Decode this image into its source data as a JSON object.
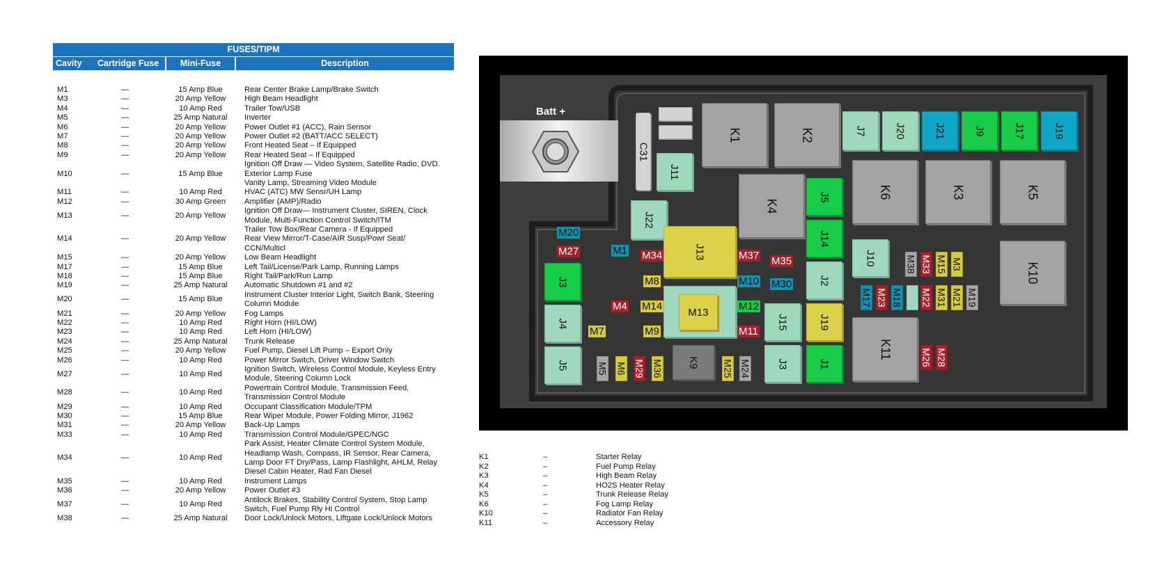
{
  "table": {
    "title": "FUSES/TIPM",
    "headers": {
      "cavity": "Cavity",
      "cartridge": "Cartridge Fuse",
      "mini": "Mini-Fuse",
      "description": "Description"
    },
    "rows": [
      {
        "cavity": "M1",
        "cartridge": "—",
        "mini": "15 Amp Blue",
        "desc": [
          "Rear Center Brake Lamp/Brake Switch"
        ]
      },
      {
        "cavity": "M3",
        "cartridge": "—",
        "mini": "20 Amp Yellow",
        "desc": [
          "High Beam Headlight"
        ]
      },
      {
        "cavity": "M4",
        "cartridge": "—",
        "mini": "10 Amp Red",
        "desc": [
          "Trailer Tow/USB"
        ]
      },
      {
        "cavity": "M5",
        "cartridge": "—",
        "mini": "25 Amp Natural",
        "desc": [
          "Inverter"
        ]
      },
      {
        "cavity": "M6",
        "cartridge": "—",
        "mini": "20 Amp Yellow",
        "desc": [
          "Power Outlet #1 (ACC), Rain Sensor"
        ]
      },
      {
        "cavity": "M7",
        "cartridge": "—",
        "mini": "20 Amp Yellow",
        "desc": [
          "Power Outlet #2 (BATT/ACC SELECT)"
        ]
      },
      {
        "cavity": "M8",
        "cartridge": "—",
        "mini": "20 Amp Yellow",
        "desc": [
          "Front Heated Seat – If Equipped"
        ]
      },
      {
        "cavity": "M9",
        "cartridge": "—",
        "mini": "20 Amp Yellow",
        "desc": [
          "Rear Heated Seat – If Equipped"
        ]
      },
      {
        "cavity": "M10",
        "cartridge": "—",
        "mini": "15 Amp Blue",
        "desc": [
          "Ignition Off Draw — Video System, Satellite Radio, DVD.",
          "Exterior Lamp Fuse",
          "Vanity Lamp, Streaming Video Module"
        ]
      },
      {
        "cavity": "M11",
        "cartridge": "—",
        "mini": "10 Amp Red",
        "desc": [
          "HVAC (ATC) MW Sensr/UH Lamp"
        ]
      },
      {
        "cavity": "M12",
        "cartridge": "—",
        "mini": "30 Amp Green",
        "desc": [
          "Amplifier (AMP)/Radio"
        ]
      },
      {
        "cavity": "M13",
        "cartridge": "—",
        "mini": "20 Amp Yellow",
        "desc": [
          "Ignition Off Draw— Instrument Cluster, SIREN, Clock",
          "Module, Multi-Function Control Switch/ITM"
        ]
      },
      {
        "cavity": "M14",
        "cartridge": "—",
        "mini": "20 Amp Yellow",
        "desc": [
          "Trailer Tow Box/Rear Camera - If Equipped",
          "Rear View Mirror/T-Case/AIR Susp/Powr Seat/",
          "CCN/Multicl"
        ]
      },
      {
        "cavity": "M15",
        "cartridge": "—",
        "mini": "20 Amp Yellow",
        "desc": [
          "Low Beam Headlight"
        ]
      },
      {
        "cavity": "M17",
        "cartridge": "—",
        "mini": "15 Amp Blue",
        "desc": [
          "Left Tail/License/Park Lamp, Running Lamps"
        ]
      },
      {
        "cavity": "M18",
        "cartridge": "—",
        "mini": "15 Amp Blue",
        "desc": [
          "Right Tail/Park/Run Lamp"
        ]
      },
      {
        "cavity": "M19",
        "cartridge": "—",
        "mini": "25 Amp Natural",
        "desc": [
          "Automatic Shutdown #1 and #2"
        ]
      },
      {
        "cavity": "M20",
        "cartridge": "—",
        "mini": "15 Amp Blue",
        "desc": [
          "Instrument Cluster Interior Light, Switch Bank, Steering",
          "Column Module"
        ]
      },
      {
        "cavity": "M21",
        "cartridge": "—",
        "mini": "20 Amp Yellow",
        "desc": [
          "Fog Lamps"
        ]
      },
      {
        "cavity": "M22",
        "cartridge": "—",
        "mini": "10 Amp Red",
        "desc": [
          "Right Horn (HI/LOW)"
        ]
      },
      {
        "cavity": "M23",
        "cartridge": "—",
        "mini": "10 Amp Red",
        "desc": [
          "Left Horn (HI/LOW)"
        ]
      },
      {
        "cavity": "M24",
        "cartridge": "—",
        "mini": "25 Amp Natural",
        "desc": [
          "Trunk Release"
        ]
      },
      {
        "cavity": "M25",
        "cartridge": "—",
        "mini": "20 Amp Yellow",
        "desc": [
          "Fuel Pump, Diesel Lift Pump – Export Only"
        ]
      },
      {
        "cavity": "M26",
        "cartridge": "—",
        "mini": "10 Amp Red",
        "desc": [
          "Power Mirror Switch, Driver Window Switch"
        ]
      },
      {
        "cavity": "M27",
        "cartridge": "—",
        "mini": "10 Amp Red",
        "desc": [
          "Ignition Switch, Wireless Control Module, Keyless Entry",
          "Module, Steering Column Lock"
        ]
      },
      {
        "cavity": "M28",
        "cartridge": "—",
        "mini": "10 Amp Red",
        "desc": [
          "Powertrain Control Module, Transmission Feed,",
          "Transmission Control Module"
        ]
      },
      {
        "cavity": "M29",
        "cartridge": "—",
        "mini": "10 Amp Red",
        "desc": [
          "Occupant Classification Module/TPM"
        ]
      },
      {
        "cavity": "M30",
        "cartridge": "—",
        "mini": "15 Amp Blue",
        "desc": [
          "Rear Wiper Module, Power Folding Mirror, J1962"
        ]
      },
      {
        "cavity": "M31",
        "cartridge": "—",
        "mini": "20 Amp Yellow",
        "desc": [
          "Back-Up Lamps"
        ]
      },
      {
        "cavity": "M33",
        "cartridge": "—",
        "mini": "10 Amp Red",
        "desc": [
          "Transmission Control Module/GPEC/NGC"
        ]
      },
      {
        "cavity": "M34",
        "cartridge": "—",
        "mini": "10 Amp Red",
        "desc": [
          "Park Assist, Heater Climate Control System Module,",
          "Headlamp Wash, Compass, IR Sensor, Rear Camera,",
          "Lamp Door FT Dry/Pass, Lamp Flashlight, AHLM, Relay",
          "Diesel Cabin Heater, Rad Fan Diesel"
        ]
      },
      {
        "cavity": "M35",
        "cartridge": "—",
        "mini": "10 Amp Red",
        "desc": [
          "Instrument Lamps"
        ]
      },
      {
        "cavity": "M36",
        "cartridge": "—",
        "mini": "20 Amp Yellow",
        "desc": [
          "Power Outlet #3"
        ]
      },
      {
        "cavity": "M37",
        "cartridge": "—",
        "mini": "10 Amp Red",
        "desc": [
          "Antilock Brakes, Stability Control System, Stop Lamp",
          "Switch, Fuel Pump Rly Hi Control"
        ]
      },
      {
        "cavity": "M38",
        "cartridge": "—",
        "mini": "25 Amp Natural",
        "desc": [
          "Door Lock/Unlock Motors, Liftgate Lock/Unlock Motors"
        ]
      }
    ]
  },
  "relays": [
    {
      "id": "K1",
      "dash": "–",
      "desc": "Starter Relay"
    },
    {
      "id": "K2",
      "dash": "–",
      "desc": "Fuel Pump Relay"
    },
    {
      "id": "K3",
      "dash": "–",
      "desc": "High Beam Relay"
    },
    {
      "id": "K4",
      "dash": "–",
      "desc": "HO2S Heater Relay"
    },
    {
      "id": "K5",
      "dash": "–",
      "desc": "Trunk Release Relay"
    },
    {
      "id": "K6",
      "dash": "–",
      "desc": "Fog Lamp Relay"
    },
    {
      "id": "K10",
      "dash": "–",
      "desc": "Radiator Fan Relay"
    },
    {
      "id": "K11",
      "dash": "–",
      "desc": "Accessory Relay"
    }
  ],
  "diagram": {
    "batt_label": "Batt +",
    "colors": {
      "red": "#a8202a",
      "blue": "#1591b0",
      "yellow": "#d6cb3e",
      "green": "#18cc4a",
      "natural": "#a6a6a6",
      "mint": "#9fd8bd",
      "relay": "#a3a3a3"
    },
    "labels": {
      "K1": "K1",
      "K2": "K2",
      "K3": "K3",
      "K4": "K4",
      "K5": "K5",
      "K6": "K6",
      "K9": "K9",
      "K10": "K10",
      "K11": "K11",
      "J1": "J1",
      "J2": "J2",
      "J3a": "J3",
      "J3b": "J3",
      "J4": "J4",
      "J5a": "J5",
      "J5b": "J5",
      "J7": "J7",
      "J9": "J9",
      "J10": "J10",
      "J11": "J11",
      "J13": "J13",
      "J14": "J14",
      "J15": "J15",
      "J17": "J17",
      "J19a": "J19",
      "J19b": "J19",
      "J20": "J20",
      "J21": "J21",
      "J22": "J22",
      "C31": "C31",
      "M13": "M13",
      "M1": "M1",
      "M3": "M3",
      "M4": "M4",
      "M5": "M5",
      "M6": "M6",
      "M7": "M7",
      "M8": "M8",
      "M9": "M9",
      "M10": "M10",
      "M11": "M11",
      "M12": "M12",
      "M14": "M14",
      "M15": "M15",
      "M17": "M17",
      "M18": "M18",
      "M19": "M19",
      "M20": "M20",
      "M21": "M21",
      "M22": "M22",
      "M23": "M23",
      "M24": "M24",
      "M25": "M25",
      "M26": "M26",
      "M27": "M27",
      "M28": "M28",
      "M29": "M29",
      "M30": "M30",
      "M31": "M31",
      "M33": "M33",
      "M34": "M34",
      "M35": "M35",
      "M36": "M36",
      "M37": "M37",
      "M38": "M38"
    }
  }
}
